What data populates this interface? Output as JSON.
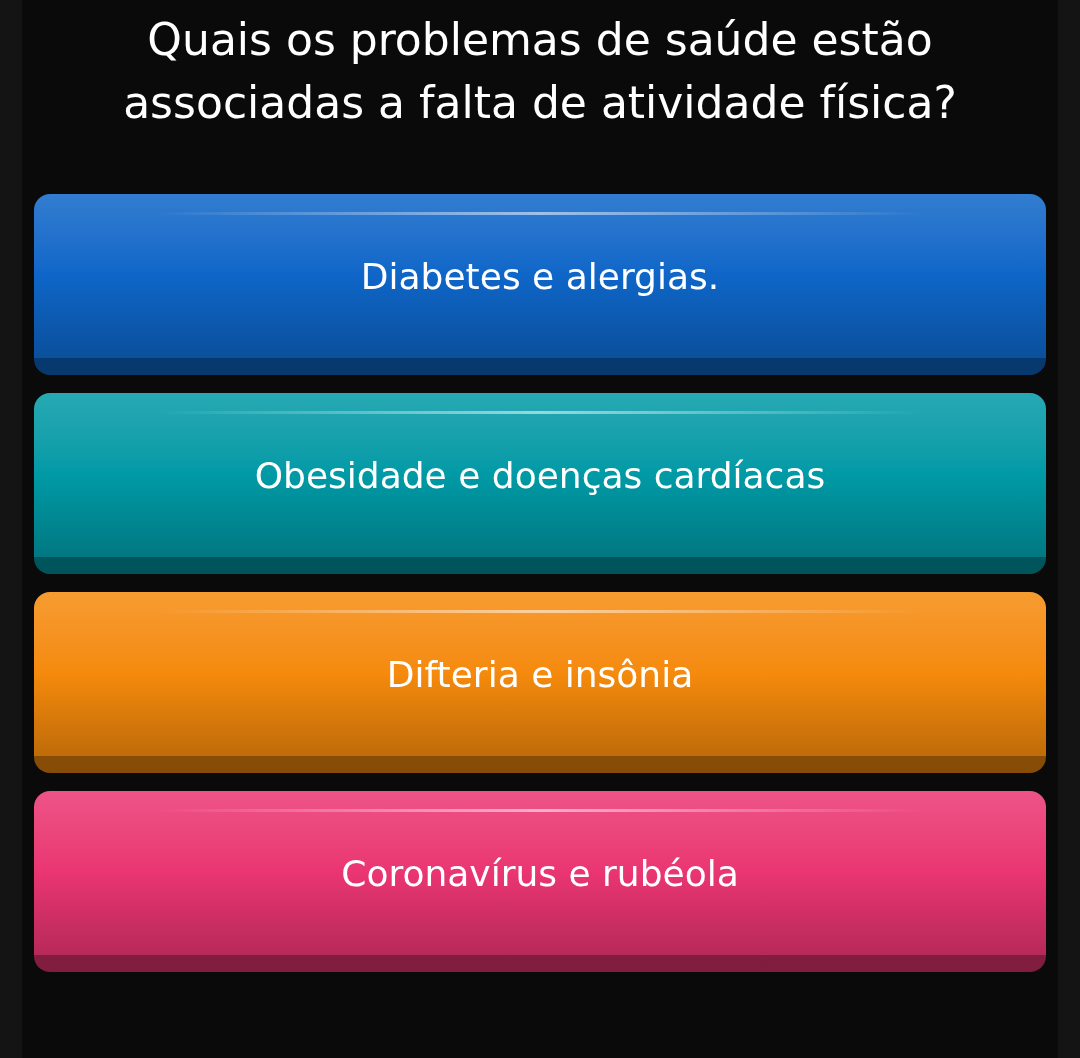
{
  "question": "Quais os problemas de saúde estão associadas a falta de atividade física?",
  "answers": [
    {
      "label": "Diabetes e alergias.",
      "color": "#0e66c8"
    },
    {
      "label": "Obesidade e doenças cardíacas",
      "color": "#009aa6"
    },
    {
      "label": "Difteria e insônia",
      "color": "#f58a0c"
    },
    {
      "label": "Coronavírus e rubéola",
      "color": "#ea3572"
    }
  ]
}
